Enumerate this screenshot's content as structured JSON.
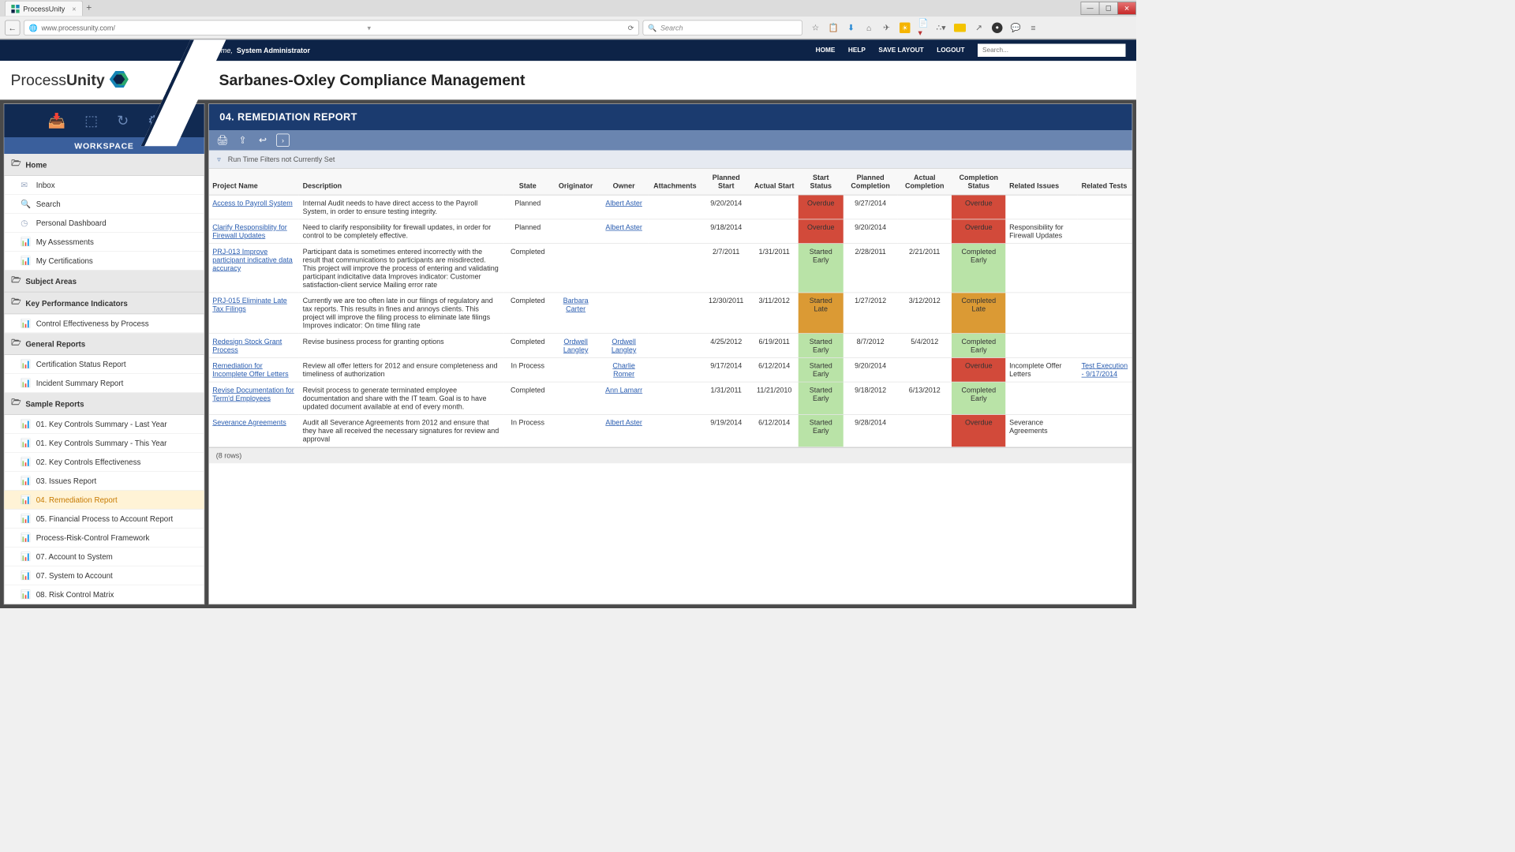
{
  "browser": {
    "tab_title": "ProcessUnity",
    "url": "www.processunity.com/",
    "search_placeholder": "Search"
  },
  "header": {
    "welcome_prefix": "Welcome,",
    "user": "System Administrator",
    "nav": {
      "home": "HOME",
      "help": "HELP",
      "save_layout": "SAVE LAYOUT",
      "logout": "LOGOUT"
    },
    "search_placeholder": "Search...",
    "logo_plain": "Process",
    "logo_bold": "Unity",
    "page_title": "Sarbanes-Oxley Compliance Management"
  },
  "sidebar": {
    "title": "WORKSPACE",
    "sections": [
      {
        "label": "Home",
        "items": [
          "Inbox",
          "Search",
          "Personal Dashboard",
          "My Assessments",
          "My Certifications"
        ]
      },
      {
        "label": "Subject Areas",
        "items": []
      },
      {
        "label": "Key Performance Indicators",
        "items": [
          "Control Effectiveness by Process"
        ]
      },
      {
        "label": "General Reports",
        "items": [
          "Certification Status Report",
          "Incident Summary Report"
        ]
      },
      {
        "label": "Sample Reports",
        "items": [
          "01. Key Controls Summary - Last Year",
          "01. Key Controls Summary - This Year",
          "02. Key Controls Effectiveness",
          "03. Issues Report",
          "04. Remediation Report",
          "05. Financial Process to Account Report",
          "Process-Risk-Control Framework",
          "07. Account to System",
          "07. System to Account",
          "08. Risk Control Matrix"
        ]
      }
    ],
    "active": "04. Remediation Report"
  },
  "report": {
    "title": "04. REMEDIATION REPORT",
    "filter_text": "Run Time Filters not Currently Set",
    "columns": [
      "Project Name",
      "Description",
      "State",
      "Originator",
      "Owner",
      "Attachments",
      "Planned Start",
      "Actual Start",
      "Start Status",
      "Planned Completion",
      "Actual Completion",
      "Completion Status",
      "Related Issues",
      "Related Tests"
    ],
    "row_count_label": "(8 rows)",
    "rows": [
      {
        "project": "Access to Payroll System",
        "description": "Internal Audit needs to have direct access to the Payroll System, in order to ensure testing integrity.",
        "state": "Planned",
        "originator": "",
        "owner": "Albert Aster",
        "attachments": "",
        "planned_start": "9/20/2014",
        "actual_start": "",
        "start_status": "Overdue",
        "start_status_class": "st-overdue",
        "planned_completion": "9/27/2014",
        "actual_completion": "",
        "completion_status": "Overdue",
        "completion_status_class": "st-overdue",
        "related_issues": "",
        "related_tests": ""
      },
      {
        "project": "Clarify Responsiblity for Firewall Updates",
        "description": "Need to clarify responsibility for firewall updates, in order for control to be completely effective.",
        "state": "Planned",
        "originator": "",
        "owner": "Albert Aster",
        "attachments": "",
        "planned_start": "9/18/2014",
        "actual_start": "",
        "start_status": "Overdue",
        "start_status_class": "st-overdue",
        "planned_completion": "9/20/2014",
        "actual_completion": "",
        "completion_status": "Overdue",
        "completion_status_class": "st-overdue",
        "related_issues": "Responsibility for Firewall Updates",
        "related_tests": ""
      },
      {
        "project": "PRJ-013 Improve participant indicative data accuracy",
        "description": "Participant data is sometimes entered incorrectly with the result that communications to participants are misdirected. This project will improve the process of entering and validating participant indicitative data Improves indicator: Customer satisfaction-client service Mailing error rate",
        "state": "Completed",
        "originator": "",
        "owner": "",
        "attachments": "",
        "planned_start": "2/7/2011",
        "actual_start": "1/31/2011",
        "start_status": "Started Early",
        "start_status_class": "st-early",
        "planned_completion": "2/28/2011",
        "actual_completion": "2/21/2011",
        "completion_status": "Completed Early",
        "completion_status_class": "st-early",
        "related_issues": "",
        "related_tests": ""
      },
      {
        "project": "PRJ-015 Eliminate Late Tax Filings",
        "description": "Currently we are too often late in our filings of regulatory and tax reports. This results in fines and annoys clients. This project will improve the filing process to eliminate late filings Improves indicator: On time filing rate",
        "state": "Completed",
        "originator": "Barbara Carter",
        "owner": "",
        "attachments": "",
        "planned_start": "12/30/2011",
        "actual_start": "3/11/2012",
        "start_status": "Started Late",
        "start_status_class": "st-late",
        "planned_completion": "1/27/2012",
        "actual_completion": "3/12/2012",
        "completion_status": "Completed Late",
        "completion_status_class": "st-late",
        "related_issues": "",
        "related_tests": ""
      },
      {
        "project": "Redesign Stock Grant Process",
        "description": "Revise business process for granting options",
        "state": "Completed",
        "originator": "Ordwell Langley",
        "owner": "Ordwell Langley",
        "attachments": "",
        "planned_start": "4/25/2012",
        "actual_start": "6/19/2011",
        "start_status": "Started Early",
        "start_status_class": "st-early",
        "planned_completion": "8/7/2012",
        "actual_completion": "5/4/2012",
        "completion_status": "Completed Early",
        "completion_status_class": "st-early",
        "related_issues": "",
        "related_tests": ""
      },
      {
        "project": "Remediation for Incomplete Offer Letters",
        "description": "Review all offer letters for 2012 and ensure completeness and timeliness of authorization",
        "state": "In Process",
        "originator": "",
        "owner": "Charlie Romer",
        "attachments": "",
        "planned_start": "9/17/2014",
        "actual_start": "6/12/2014",
        "start_status": "Started Early",
        "start_status_class": "st-early",
        "planned_completion": "9/20/2014",
        "actual_completion": "",
        "completion_status": "Overdue",
        "completion_status_class": "st-overdue",
        "related_issues": "Incomplete Offer Letters",
        "related_tests": "Test Execution - 9/17/2014",
        "related_tests_link": true
      },
      {
        "project": "Revise Documentation for Term'd Employees",
        "description": "Revisit process to generate terminated employee documentation and share with the IT team. Goal is to have updated document available at end of every month.",
        "state": "Completed",
        "originator": "",
        "owner": "Ann Lamarr",
        "attachments": "",
        "planned_start": "1/31/2011",
        "actual_start": "11/21/2010",
        "start_status": "Started Early",
        "start_status_class": "st-early",
        "planned_completion": "9/18/2012",
        "actual_completion": "6/13/2012",
        "completion_status": "Completed Early",
        "completion_status_class": "st-early",
        "related_issues": "",
        "related_tests": ""
      },
      {
        "project": "Severance Agreements",
        "description": "Audit all Severance Agreements from 2012 and ensure that they have all received the necessary signatures for review and approval",
        "state": "In Process",
        "originator": "",
        "owner": "Albert Aster",
        "attachments": "",
        "planned_start": "9/19/2014",
        "actual_start": "6/12/2014",
        "start_status": "Started Early",
        "start_status_class": "st-early",
        "planned_completion": "9/28/2014",
        "actual_completion": "",
        "completion_status": "Overdue",
        "completion_status_class": "st-overdue",
        "related_issues": "Severance Agreements",
        "related_tests": ""
      }
    ]
  }
}
